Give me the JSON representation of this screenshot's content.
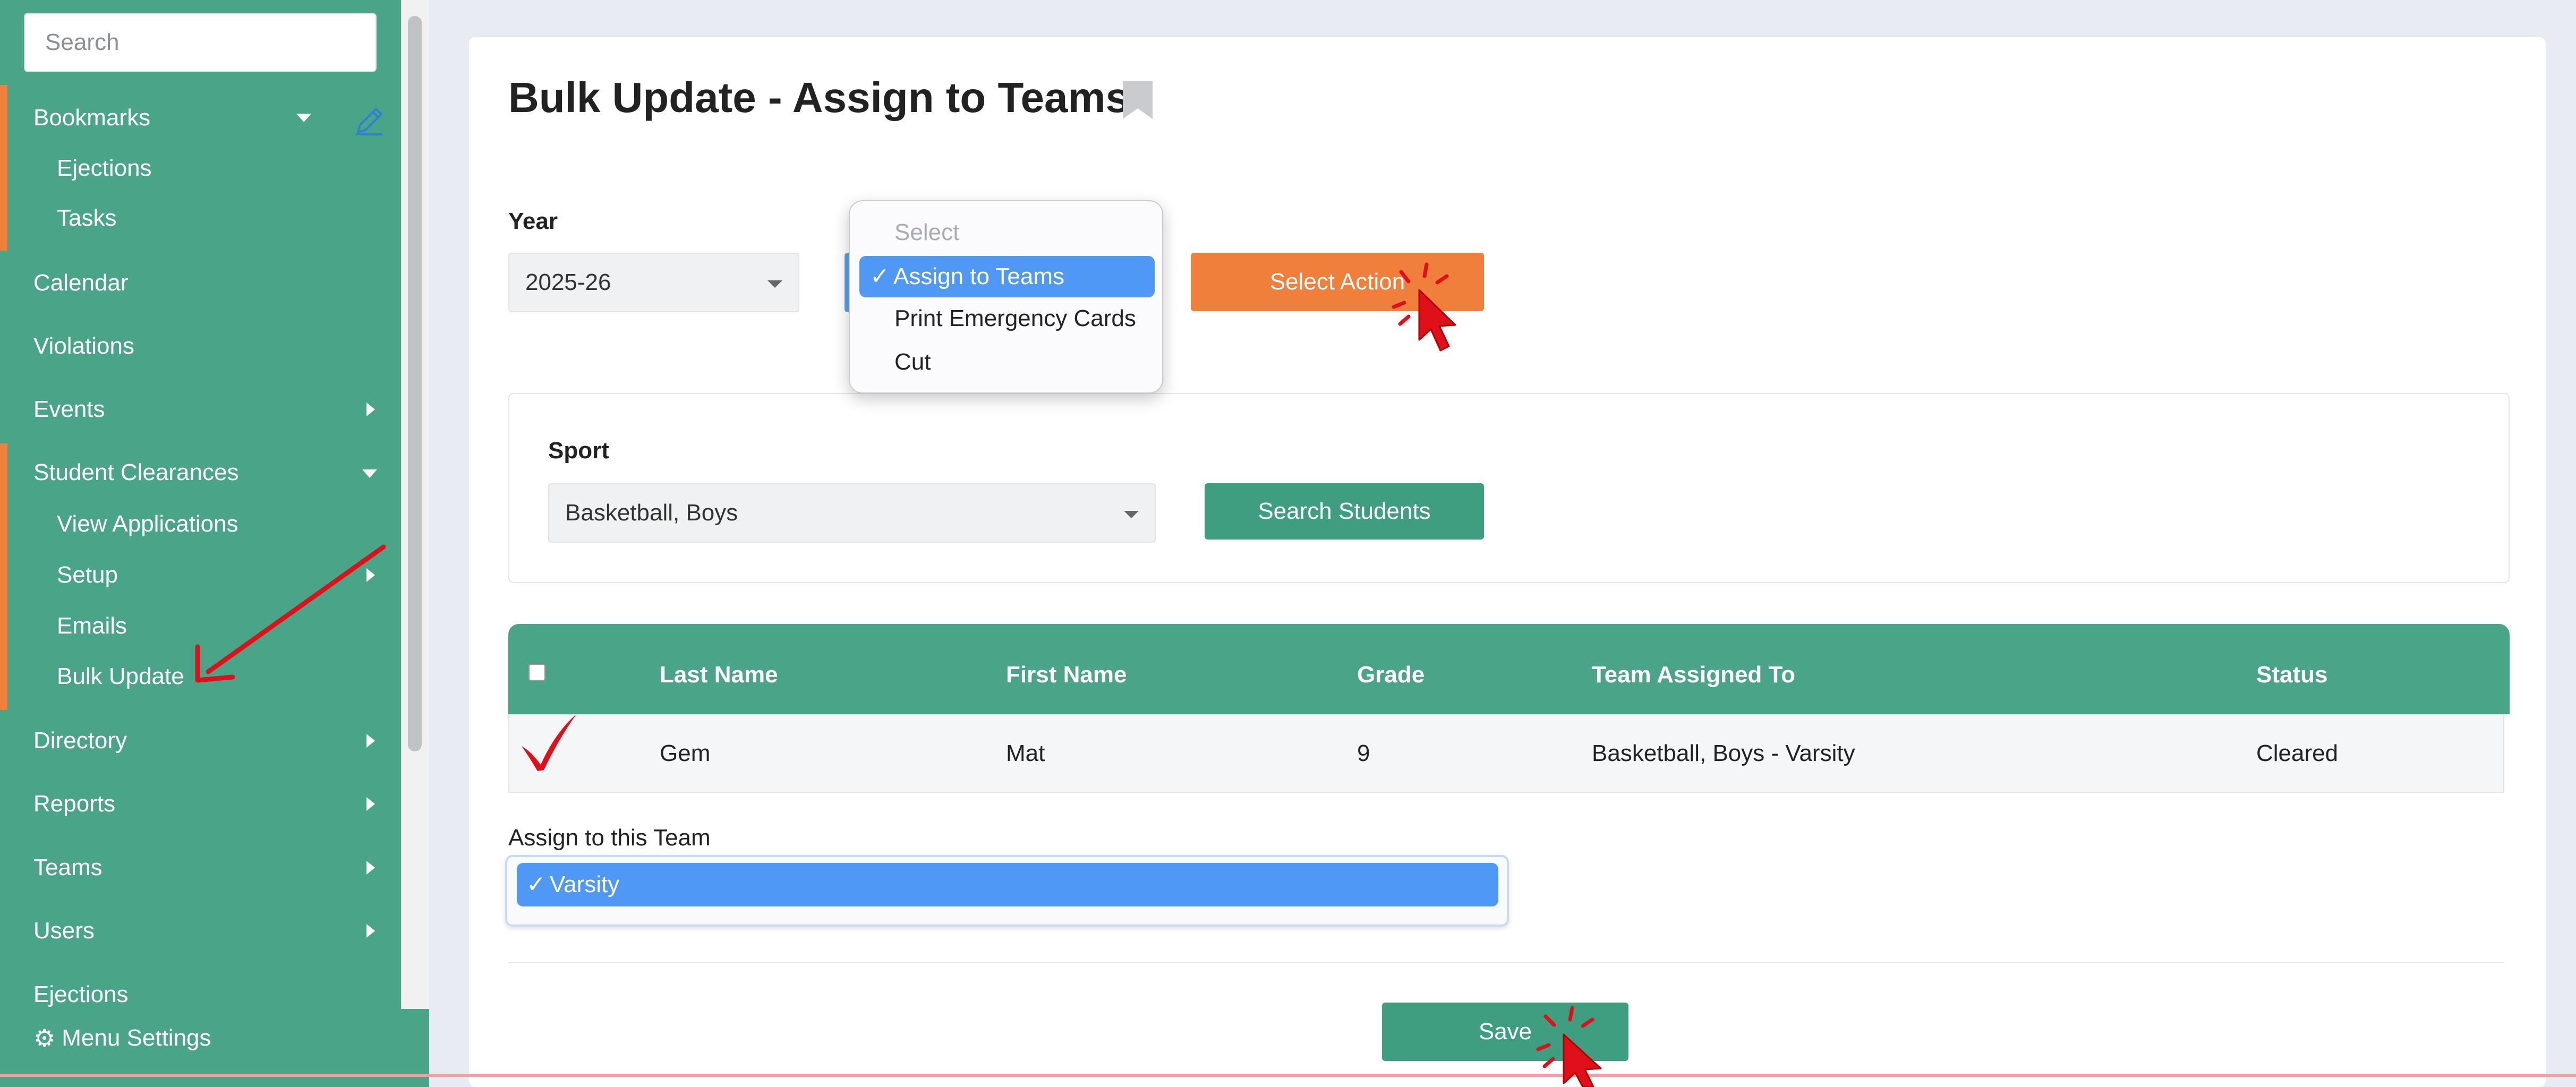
{
  "sidebar": {
    "search_placeholder": "Search",
    "items": {
      "bookmarks": "Bookmarks",
      "ejections_sub": "Ejections",
      "tasks": "Tasks",
      "calendar": "Calendar",
      "violations": "Violations",
      "events": "Events",
      "student_clearances": "Student Clearances",
      "view_applications": "View Applications",
      "setup": "Setup",
      "emails": "Emails",
      "bulk_update": "Bulk Update",
      "directory": "Directory",
      "reports": "Reports",
      "teams": "Teams",
      "users": "Users",
      "ejections": "Ejections"
    },
    "menu_settings": "Menu Settings"
  },
  "page": {
    "title": "Bulk Update - Assign to Teams"
  },
  "year": {
    "label": "Year",
    "value": "2025-26"
  },
  "action_dropdown": {
    "options": [
      "Select",
      "Assign to Teams",
      "Print Emergency Cards",
      "Cut"
    ],
    "selected": "Assign to Teams"
  },
  "select_action_button": "Select Action",
  "sport": {
    "label": "Sport",
    "value": "Basketball, Boys"
  },
  "search_students_button": "Search Students",
  "table": {
    "columns": [
      "Last Name",
      "First Name",
      "Grade",
      "Team Assigned To",
      "Status"
    ],
    "rows": [
      {
        "last_name": "Gem",
        "first_name": "Mat",
        "grade": "9",
        "team": "Basketball, Boys - Varsity",
        "status": "Cleared"
      }
    ]
  },
  "assign_team": {
    "label": "Assign to this Team",
    "selected": "Varsity"
  },
  "save_button": "Save",
  "colors": {
    "sidebar_green": "#4aa588",
    "accent_orange": "#f07f3c",
    "selection_blue": "#4f98f4",
    "annotation_red": "#e0101a"
  },
  "icons": [
    "pencil-icon",
    "bookmark-icon",
    "gear-icon",
    "checkmark-icon",
    "arrow-annotation",
    "cursor-icon"
  ]
}
